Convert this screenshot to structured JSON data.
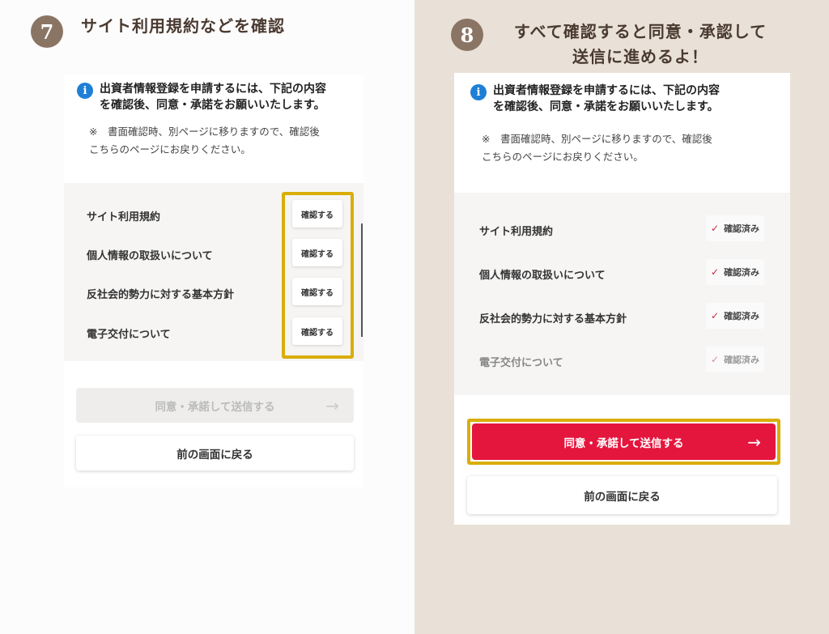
{
  "colors": {
    "accent": "#e4163e",
    "highlight": "#d9ae09",
    "badge": "#8a7565",
    "info": "#1f7fd6",
    "right_background": "#e9e1d7"
  },
  "left": {
    "step_number": "7",
    "step_title": "サイト利用規約などを確認",
    "notice_line1": "出資者情報登録を申請するには、下記の内容",
    "notice_line2": "を確認後、同意・承諾をお願いいたします。",
    "note_line1": "※　書面確認時、別ページに移りますので、確認後",
    "note_line2": "こちらのページにお戻りください。",
    "documents": [
      {
        "label": "サイト利用規約",
        "button": "確認する"
      },
      {
        "label": "個人情報の取扱いについて",
        "button": "確認する"
      },
      {
        "label": "反社会的勢力に対する基本方針",
        "button": "確認する"
      },
      {
        "label": "電子交付について",
        "button": "確認する"
      }
    ],
    "submit_label": "同意・承諾して送信する",
    "submit_arrow": "→",
    "back_label": "前の画面に戻る"
  },
  "right": {
    "step_number": "8",
    "step_title_line1": "すべて確認すると同意・承認して",
    "step_title_line2": "送信に進めるよ！",
    "notice_line1": "出資者情報登録を申請するには、下記の内容",
    "notice_line2": "を確認後、同意・承諾をお願いいたします。",
    "note_line1": "※　書面確認時、別ページに移りますので、確認後",
    "note_line2": "こちらのページにお戻りください。",
    "documents": [
      {
        "label": "サイト利用規約",
        "status": "確認済み"
      },
      {
        "label": "個人情報の取扱いについて",
        "status": "確認済み"
      },
      {
        "label": "反社会的勢力に対する基本方針",
        "status": "確認済み"
      },
      {
        "label": "電子交付について",
        "status": "確認済み"
      }
    ],
    "submit_label": "同意・承諾して送信する",
    "submit_arrow": "→",
    "back_label": "前の画面に戻る"
  },
  "icons": {
    "info": "i",
    "check": "✓"
  }
}
